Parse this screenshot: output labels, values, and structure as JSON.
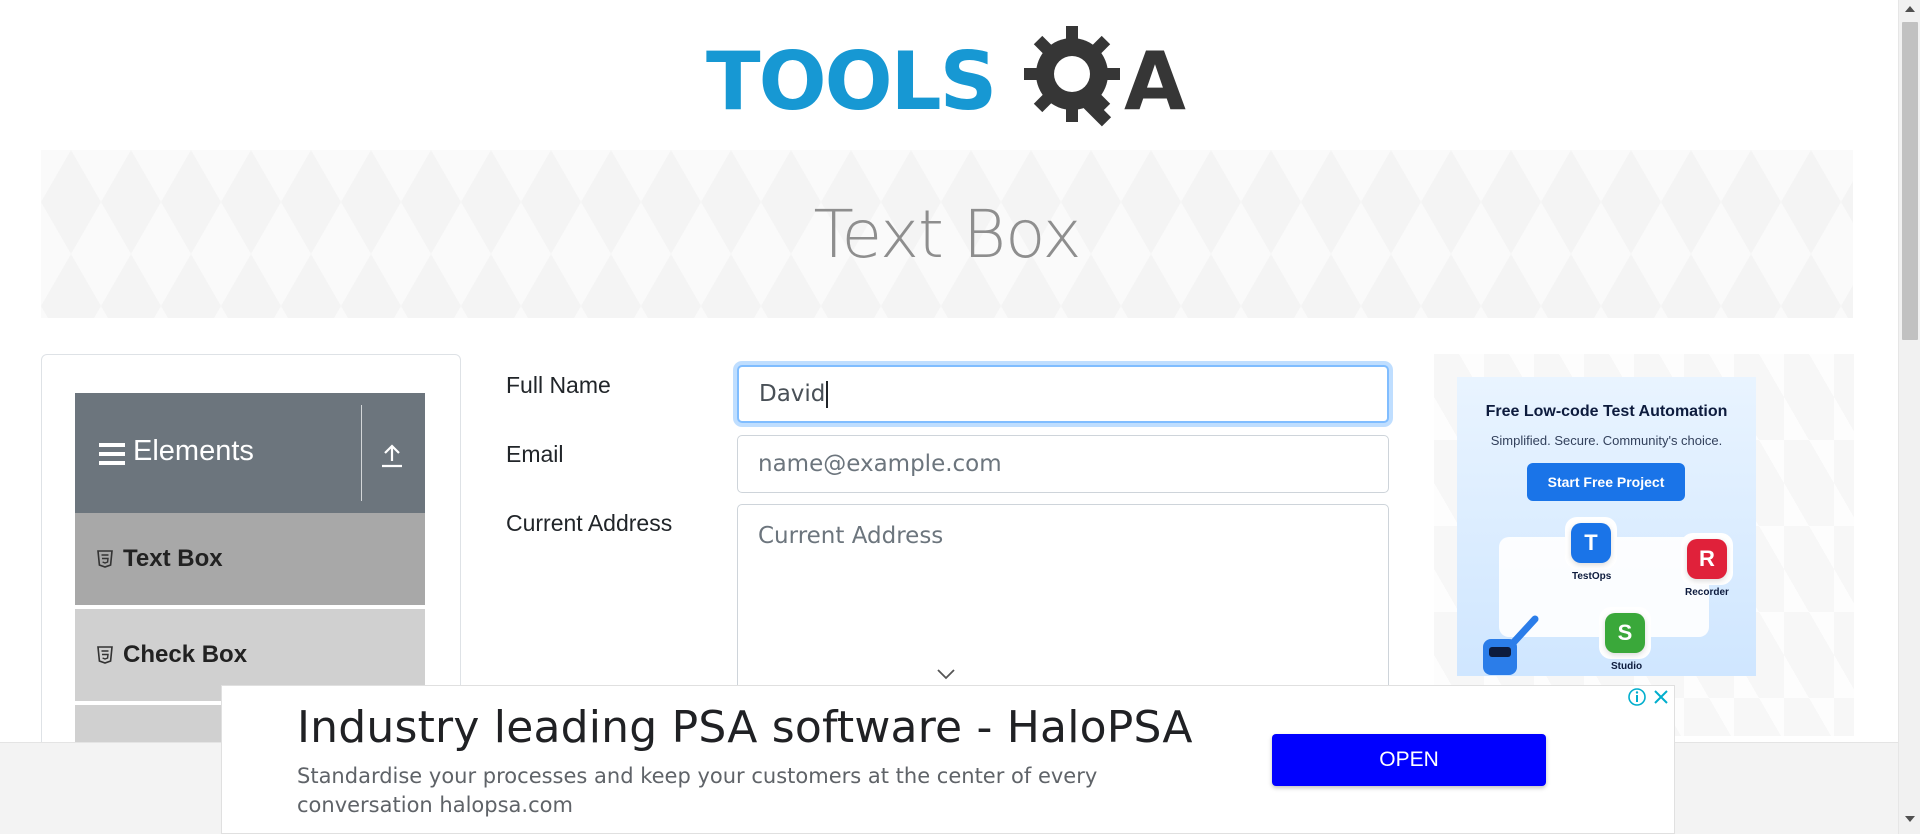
{
  "logo": {
    "part1": "TOOLS",
    "part2": "A",
    "icon": "gear-magnifier-icon"
  },
  "banner": {
    "title": "Text Box"
  },
  "sidebar": {
    "group_title": "Elements",
    "items": [
      {
        "label": "Text Box",
        "active": true
      },
      {
        "label": "Check Box",
        "active": false
      }
    ]
  },
  "form": {
    "full_name": {
      "label": "Full Name",
      "value": "David"
    },
    "email": {
      "label": "Email",
      "placeholder": "name@example.com"
    },
    "current_address": {
      "label": "Current Address",
      "placeholder": "Current Address"
    }
  },
  "right_ad": {
    "title": "Free Low-code Test Automation",
    "subtitle": "Simplified. Secure. Community's choice.",
    "button": "Start Free Project",
    "tiles": [
      {
        "letter": "T",
        "label": "TestOps",
        "color": "#1a74e8"
      },
      {
        "letter": "R",
        "label": "Recorder",
        "color": "#e0213a"
      },
      {
        "letter": "S",
        "label": "Studio",
        "color": "#3aa83a"
      }
    ]
  },
  "bottom_ad": {
    "title": "Industry leading PSA software - HaloPSA",
    "description": "Standardise your processes and keep your customers at the center of every conversation halopsa.com",
    "button": "OPEN"
  },
  "colors": {
    "brand_blue": "#1798d3",
    "brand_dark": "#363636",
    "sidebar_header": "#6c757d",
    "active_item": "#a8a8a8",
    "focus_border": "#80bdff",
    "ad_button": "#0000ff"
  }
}
